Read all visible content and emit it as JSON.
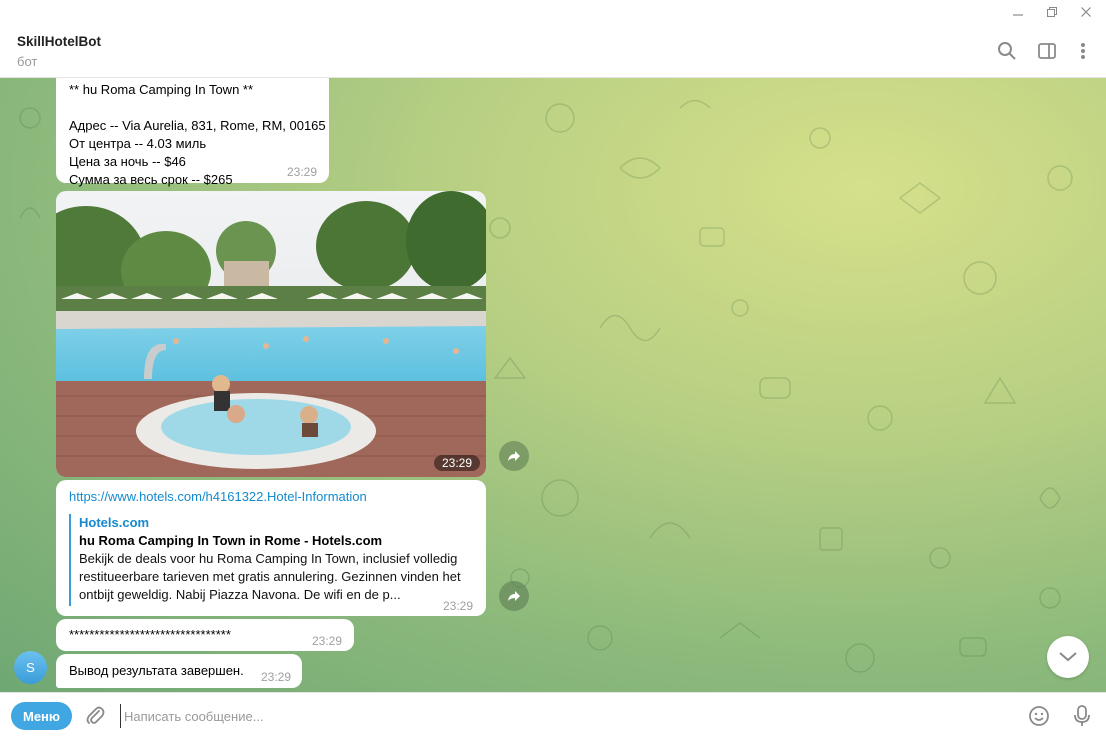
{
  "chat": {
    "bot_name": "SkillHotelBot",
    "bot_status": "бот"
  },
  "messages": {
    "hotel_card": {
      "title": "** hu Roma Camping In Town **",
      "address": "Адрес -- Via Aurelia, 831, Rome, RM, 00165",
      "distance": "От центра -- 4.03 миль",
      "price_night": "Цена за ночь -- $46",
      "price_total": "Сумма за весь срок -- $265",
      "time": "23:29"
    },
    "photo": {
      "time": "23:29"
    },
    "link": {
      "url": "https://www.hotels.com/h4161322.Hotel-Information",
      "site": "Hotels.com",
      "title": "hu Roma Camping In Town in Rome - Hotels.com",
      "description": "Bekijk de deals voor hu Roma Camping In Town, inclusief volledig restitueerbare tarieven met gratis annulering. Gezinnen vinden het ontbijt geweldig. Nabij Piazza Navona. De wifi en de p...",
      "time": "23:29"
    },
    "separator": {
      "text": "********************************",
      "time": "23:29"
    },
    "done": {
      "text": "Вывод результата завершен.",
      "time": "23:29"
    }
  },
  "avatar": {
    "letter": "S"
  },
  "composer": {
    "menu_label": "Меню",
    "placeholder": "Написать сообщение..."
  },
  "colors": {
    "accent": "#40a7e3",
    "link": "#168acd"
  }
}
